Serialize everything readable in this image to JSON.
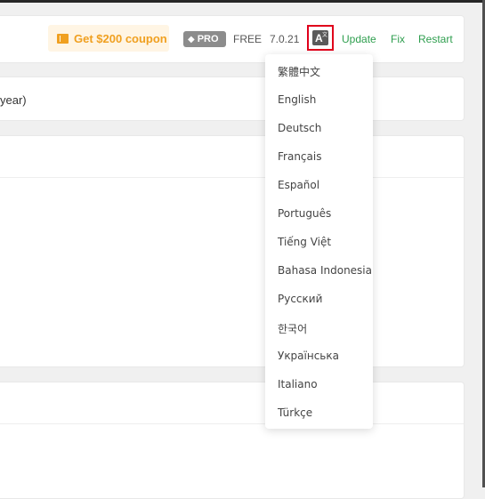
{
  "header": {
    "coupon_label": "Get $200 coupon",
    "pro_label": "PRO",
    "plan_label": "FREE",
    "version": "7.0.21",
    "language_button_letter": "A",
    "update_label": "Update",
    "fix_label": "Fix",
    "restart_label": "Restart"
  },
  "card2": {
    "partial_text": "year)"
  },
  "language_menu": {
    "items": [
      "繁體中文",
      "English",
      "Deutsch",
      "Français",
      "Español",
      "Português",
      "Tiếng Việt",
      "Bahasa Indonesia",
      "Русский",
      "한국어",
      "Українська",
      "Italiano",
      "Türkçe"
    ]
  },
  "colors": {
    "accent_green": "#2e9e4e",
    "coupon_orange": "#f0a020",
    "highlight_red": "#e0001b"
  }
}
